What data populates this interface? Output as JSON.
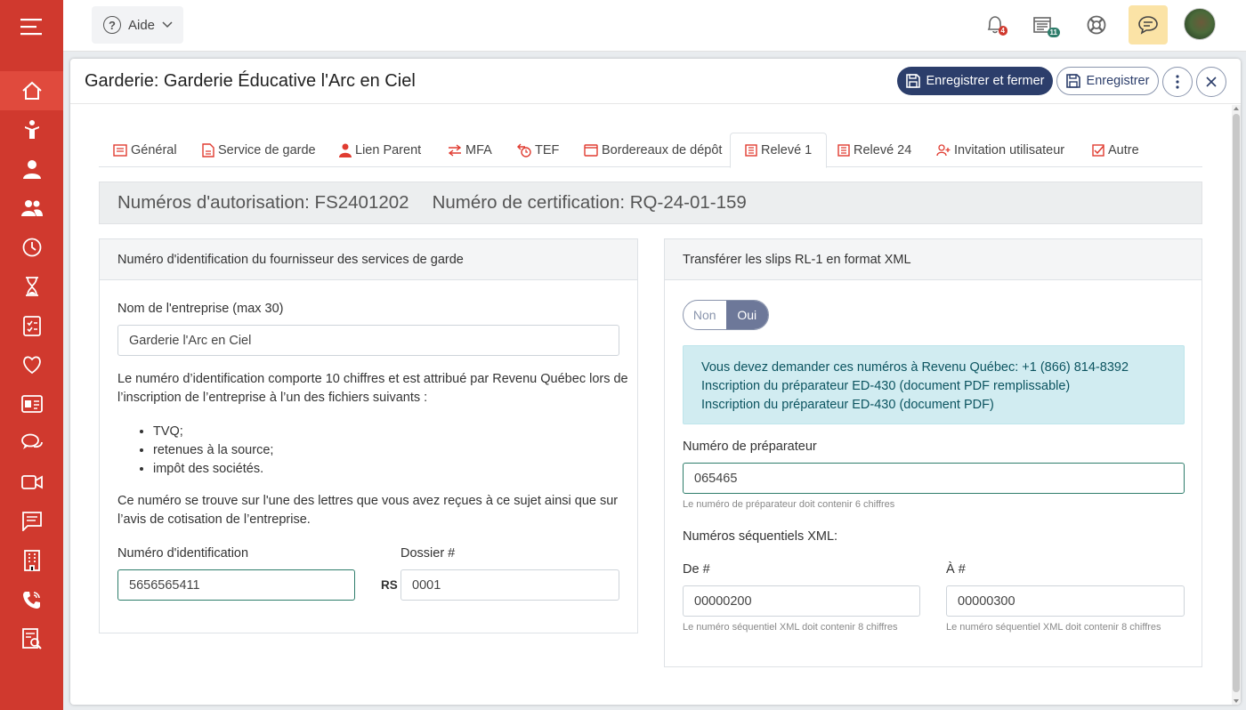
{
  "topbar": {
    "help_label": "Aide",
    "notifications_count": "4",
    "calendar_count": "11",
    "colors": {
      "notif_badge": "#d0392e",
      "calendar_badge": "#2e7d6b",
      "chat_bg": "#fbe3a6"
    }
  },
  "sidebar": {
    "items": [
      "home-icon",
      "child-icon",
      "person-icon",
      "group-icon",
      "clock-icon",
      "hourglass-icon",
      "checklist-icon",
      "heart-icon",
      "id-card-icon",
      "chat-bubbles-icon",
      "video-icon",
      "message-icon",
      "building-icon",
      "phone-icon",
      "report-icon"
    ],
    "color": "#d0392e"
  },
  "modal": {
    "title": "Garderie: Garderie Éducative l'Arc en Ciel",
    "save_close_label": "Enregistrer et fermer",
    "save_label": "Enregistrer"
  },
  "tabs": [
    {
      "label": "Général"
    },
    {
      "label": "Service de garde"
    },
    {
      "label": "Lien Parent"
    },
    {
      "label": "MFA"
    },
    {
      "label": "TEF"
    },
    {
      "label": "Bordereaux de dépôt"
    },
    {
      "label": "Relevé 1",
      "active": true
    },
    {
      "label": "Relevé 24"
    },
    {
      "label": "Invitation utilisateur"
    },
    {
      "label": "Autre"
    }
  ],
  "banner": {
    "authorization": "Numéros d'autorisation: FS2401202",
    "certification": "Numéro de certification: RQ-24-01-159"
  },
  "left_panel": {
    "title": "Numéro d'identification du fournisseur des services de garde",
    "company_label": "Nom de l'entreprise (max 30)",
    "company_value": "Garderie l'Arc en Ciel",
    "para1_line1": "Le numéro d’identification comporte 10 chiffres et est attribué par Revenu Québec lors de",
    "para1_line2": "l’inscription de l’entreprise à l’un des fichiers suivants :",
    "bullets": [
      "TVQ;",
      "retenues à la source;",
      "impôt des sociétés."
    ],
    "para2_line1": "Ce numéro se trouve sur l'une des lettres que vous avez reçues à ce sujet ainsi que sur",
    "para2_line2": "l’avis de cotisation de l’entreprise.",
    "id_label": "Numéro d'identification",
    "id_value": "5656565411",
    "dossier_label": "Dossier #",
    "rs_label": "RS",
    "dossier_value": "0001"
  },
  "right_panel": {
    "title": "Transférer les slips RL-1 en format XML",
    "toggle_off": "Non",
    "toggle_on": "Oui",
    "toggle_selected": "Oui",
    "info_line1": "Vous devez demander ces numéros à Revenu Québec: +1 (866) 814-8392",
    "info_line2": "Inscription du préparateur ED-430 (document PDF remplissable)",
    "info_line3": "Inscription du préparateur ED-430 (document PDF)",
    "preparer_label": "Numéro de préparateur",
    "preparer_value": "065465",
    "preparer_hint": "Le numéro de préparateur doit contenir 6 chiffres",
    "seq_label": "Numéros séquentiels XML:",
    "from_label": "De #",
    "from_value": "00000200",
    "from_hint": "Le numéro séquentiel XML doit contenir 8 chiffres",
    "to_label": "À #",
    "to_value": "00000300",
    "to_hint": "Le numéro séquentiel XML doit contenir 8 chiffres"
  }
}
